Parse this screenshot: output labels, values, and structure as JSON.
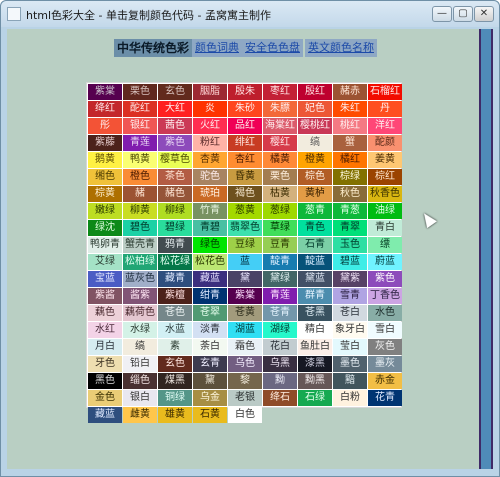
{
  "window": {
    "title": "html色彩大全 - 单击复制颜色代码 - 孟窝寓主制作"
  },
  "controls": {
    "min": "—",
    "max": "▢",
    "close": "✕"
  },
  "nav": {
    "active": "中华传统色彩",
    "links": [
      "颜色词典",
      "安全色色盘",
      "英文颜色名称"
    ]
  },
  "palette": {
    "rows": [
      [
        [
          "紫棠",
          "#56004f",
          "#cfc6cf"
        ],
        [
          "栗色",
          "#60281e",
          "#d8c2be"
        ],
        [
          "玄色",
          "#622a1d",
          "#d8c2be"
        ],
        [
          "胭脂",
          "#9d2933",
          "#ffd6d6"
        ],
        [
          "殷朱",
          "#be1e2d",
          "#ffe0e0"
        ],
        [
          "枣红",
          "#c32136",
          "#ffe0e0"
        ],
        [
          "殷红",
          "#be002f",
          "#ffe0e0"
        ],
        [
          "赭赤",
          "#9c5333",
          "#ffe6d6"
        ],
        [
          "石榴红",
          "#f20c00",
          "#ffeaea"
        ]
      ],
      [
        [
          "绛红",
          "#c3272b",
          "#ffe6e6"
        ],
        [
          "酡红",
          "#dc3023",
          "#ffe6e6"
        ],
        [
          "大红",
          "#ff2121",
          "#ffeeee"
        ],
        [
          "炎",
          "#ff3300",
          "#ffeeee"
        ],
        [
          "朱砂",
          "#ff461f",
          "#ffeeee"
        ],
        [
          "朱膘",
          "#f36838",
          "#ffeeee"
        ],
        [
          "妃色",
          "#ed5736",
          "#ffeeee"
        ],
        [
          "朱红",
          "#ff4c00",
          "#ffeeee"
        ],
        [
          "丹",
          "#ff4e20",
          "#ffeeee"
        ]
      ],
      [
        [
          "彤",
          "#f35336",
          "#ffeeee"
        ],
        [
          "银红",
          "#f05654",
          "#ffeeee"
        ],
        [
          "茜色",
          "#cb3a56",
          "#ffeeee"
        ],
        [
          "火红",
          "#ff2d51",
          "#ffeeee"
        ],
        [
          "品红",
          "#f00056",
          "#ffeeee"
        ],
        [
          "海棠红",
          "#db5a6b",
          "#ffeeee"
        ],
        [
          "樱桃红",
          "#c93756",
          "#ffeeee"
        ],
        [
          "桃红",
          "#f47983",
          "#ffeeee"
        ],
        [
          "洋红",
          "#ff4777",
          "#ffeeee"
        ]
      ],
      [
        [
          "紫藤",
          "#4c221b",
          "#e6cccc"
        ],
        [
          "青莲",
          "#801dae",
          "#ead8f4"
        ],
        [
          "紫色",
          "#8d4bbb",
          "#ead8f4"
        ],
        [
          "粉红",
          "#ffb3a7",
          "#5a2a2a"
        ],
        [
          "绯红",
          "#c83c23",
          "#ffe6e0"
        ],
        [
          "樱红",
          "#d63b4a",
          "#ffe6e6"
        ],
        [
          "缟",
          "#f2ecde",
          "#555555"
        ],
        [
          "蟹",
          "#a9613e",
          "#ffe6d6"
        ],
        [
          "酡颜",
          "#f9906f",
          "#5a2a1a"
        ]
      ],
      [
        [
          "鹅黄",
          "#fff143",
          "#5a4a00"
        ],
        [
          "鸭黄",
          "#faff72",
          "#4a4a00"
        ],
        [
          "樱草色",
          "#eaff56",
          "#4a4a00"
        ],
        [
          "杏黄",
          "#ffa631",
          "#5a3000"
        ],
        [
          "杏红",
          "#ff8c31",
          "#4a1a00"
        ],
        [
          "橘黄",
          "#ff8936",
          "#4a1a00"
        ],
        [
          "橙黄",
          "#ffa400",
          "#4a2a00"
        ],
        [
          "橘红",
          "#ff7500",
          "#4a1a00"
        ],
        [
          "姜黄",
          "#ffc773",
          "#4a2a00"
        ]
      ],
      [
        [
          "缃色",
          "#f0c239",
          "#4a3a00"
        ],
        [
          "橙色",
          "#fa8c35",
          "#4a1a00"
        ],
        [
          "茶色",
          "#b35c44",
          "#ffe6d6"
        ],
        [
          "驼色",
          "#a88462",
          "#ffeeee"
        ],
        [
          "昏黄",
          "#c89b40",
          "#3a2a00"
        ],
        [
          "栗色",
          "#a37d51",
          "#fff0e0"
        ],
        [
          "棕色",
          "#b25d25",
          "#fff0e0"
        ],
        [
          "棕绿",
          "#827100",
          "#fffadd"
        ],
        [
          "棕红",
          "#9b4400",
          "#ffe6cc"
        ]
      ],
      [
        [
          "棕黄",
          "#ae7000",
          "#fff0d0"
        ],
        [
          "赭",
          "#9c5333",
          "#ffe6d6"
        ],
        [
          "赭色",
          "#955539",
          "#ffe6d6"
        ],
        [
          "琥珀",
          "#ca6924",
          "#fff0e0"
        ],
        [
          "褐色",
          "#6e511e",
          "#f4e6cc"
        ],
        [
          "枯黄",
          "#d3b17d",
          "#3a2a00"
        ],
        [
          "黄栌",
          "#e29c45",
          "#3a2000"
        ],
        [
          "秋色",
          "#896c39",
          "#fff0d0"
        ],
        [
          "秋香色",
          "#d9b611",
          "#3a3000"
        ]
      ],
      [
        [
          "嫩绿",
          "#bddd22",
          "#2a3a00"
        ],
        [
          "柳黄",
          "#c9dd22",
          "#2a3a00"
        ],
        [
          "柳绿",
          "#afdd22",
          "#2a3a00"
        ],
        [
          "竹青",
          "#789262",
          "#e8f4e0"
        ],
        [
          "葱黄",
          "#a3d900",
          "#2a3a00"
        ],
        [
          "葱绿",
          "#9ed900",
          "#2a3a00"
        ],
        [
          "葱青",
          "#0eb83a",
          "#e0ffe6"
        ],
        [
          "青葱",
          "#0eb83a",
          "#e0ffe6"
        ],
        [
          "油绿",
          "#00bc12",
          "#e0ffe6"
        ]
      ],
      [
        [
          "绿沈",
          "#0c8918",
          "#e0ffe0"
        ],
        [
          "碧色",
          "#1bd1a5",
          "#003a2a"
        ],
        [
          "碧绿",
          "#2add9c",
          "#003a2a"
        ],
        [
          "青碧",
          "#48c0a3",
          "#003a2a"
        ],
        [
          "翡翠色",
          "#3de1ad",
          "#003a2a"
        ],
        [
          "草绿",
          "#40de5a",
          "#003a00"
        ],
        [
          "青色",
          "#00e09e",
          "#003a2a"
        ],
        [
          "青翠",
          "#00e079",
          "#003a2a"
        ],
        [
          "青白",
          "#c0ebd7",
          "#2a3a30"
        ]
      ],
      [
        [
          "鸭卵青",
          "#e0eee8",
          "#2a3a30"
        ],
        [
          "蟹壳青",
          "#bbcdc5",
          "#2a3a30"
        ],
        [
          "鸦青",
          "#424c50",
          "#e0e8ea"
        ],
        [
          "绿色",
          "#00e500",
          "#003a00"
        ],
        [
          "豆绿",
          "#9ed048",
          "#2a3a00"
        ],
        [
          "豆青",
          "#96ce54",
          "#2a3a00"
        ],
        [
          "石青",
          "#7bcfa6",
          "#003a2a"
        ],
        [
          "玉色",
          "#2edfa3",
          "#003a2a"
        ],
        [
          "缥",
          "#7fecad",
          "#003a20"
        ]
      ],
      [
        [
          "艾绿",
          "#a4e2c6",
          "#2a3a30"
        ],
        [
          "松柏绿",
          "#21a675",
          "#e0fff0"
        ],
        [
          "松花绿",
          "#057748",
          "#e0fff0"
        ],
        [
          "松花色",
          "#bce672",
          "#2a3a00"
        ],
        [
          "蓝",
          "#44cef6",
          "#002a3a"
        ],
        [
          "靛青",
          "#177cb0",
          "#e0f0ff"
        ],
        [
          "靛蓝",
          "#065279",
          "#d8ecff"
        ],
        [
          "碧蓝",
          "#3eede7",
          "#003a3a"
        ],
        [
          "蔚蓝",
          "#70f3ff",
          "#003a3a"
        ]
      ],
      [
        [
          "宝蓝",
          "#4b5cc4",
          "#e6eaff"
        ],
        [
          "蓝灰色",
          "#a1afc9",
          "#1a2a3a"
        ],
        [
          "藏青",
          "#2e4e7e",
          "#e0eaff"
        ],
        [
          "藏蓝",
          "#3b2e7e",
          "#e6e0ff"
        ],
        [
          "黛",
          "#4a4266",
          "#eae6ff"
        ],
        [
          "黛绿",
          "#426666",
          "#e0f0f0"
        ],
        [
          "黛蓝",
          "#425066",
          "#e0e8f4"
        ],
        [
          "黛紫",
          "#574266",
          "#eee0f4"
        ],
        [
          "紫色",
          "#8d4bbb",
          "#ffffff"
        ]
      ],
      [
        [
          "紫酱",
          "#815463",
          "#ffe6ee"
        ],
        [
          "酱紫",
          "#815476",
          "#ffe6f4"
        ],
        [
          "紫檀",
          "#4c221b",
          "#ffe0e0"
        ],
        [
          "绀青",
          "#003371",
          "#e0eaff"
        ],
        [
          "紫棠",
          "#56004f",
          "#ffe0ff"
        ],
        [
          "青莲",
          "#801dae",
          "#ffe6ff"
        ],
        [
          "群青",
          "#4c8dae",
          "#e6f4ff"
        ],
        [
          "雪青",
          "#b0a4e3",
          "#2a2040"
        ],
        [
          "丁香色",
          "#cca4e3",
          "#2a2040"
        ]
      ],
      [
        [
          "藕色",
          "#edd1d8",
          "#4a2a30"
        ],
        [
          "藕荷色",
          "#e4c6d0",
          "#4a2a30"
        ],
        [
          "苍色",
          "#75878a",
          "#eef4f4"
        ],
        [
          "苍翠",
          "#519a73",
          "#e6ffee"
        ],
        [
          "苍黄",
          "#a29b7c",
          "#2a2a1a"
        ],
        [
          "苍青",
          "#7397ab",
          "#e6f4ff"
        ],
        [
          "苍黑",
          "#395260",
          "#e0eef4"
        ],
        [
          "苍白",
          "#d1d9e0",
          "#2a3038"
        ],
        [
          "水色",
          "#88ada6",
          "#1a2a28"
        ]
      ],
      [
        [
          "水红",
          "#f3d3e7",
          "#4a2a3a"
        ],
        [
          "水绿",
          "#d4f2e7",
          "#2a3a30"
        ],
        [
          "水蓝",
          "#d2f0f4",
          "#2a3a3a"
        ],
        [
          "淡青",
          "#d3e0f3",
          "#2a303a"
        ],
        [
          "湖蓝",
          "#30dff3",
          "#003a3a"
        ],
        [
          "湖绿",
          "#25f8cb",
          "#003a30"
        ],
        [
          "精白",
          "#ffffff",
          "#333333"
        ],
        [
          "象牙白",
          "#fffbf0",
          "#333333"
        ],
        [
          "雪白",
          "#f0fcff",
          "#333333"
        ]
      ],
      [
        [
          "月白",
          "#d6ecf0",
          "#2a3038"
        ],
        [
          "缟",
          "#f2ecde",
          "#333333"
        ],
        [
          "素",
          "#e0f0e9",
          "#2a3a30"
        ],
        [
          "荼白",
          "#f3f9f1",
          "#333333"
        ],
        [
          "霜色",
          "#e9f1f6",
          "#333333"
        ],
        [
          "花白",
          "#c2ccd0",
          "#2a3038"
        ],
        [
          "鱼肚白",
          "#fcefe8",
          "#333333"
        ],
        [
          "莹白",
          "#e3f9fd",
          "#333333"
        ],
        [
          "灰色",
          "#808080",
          "#f4f4f4"
        ]
      ],
      [
        [
          "牙色",
          "#eedeb0",
          "#3a3020"
        ],
        [
          "铅白",
          "#f0f0f4",
          "#333333"
        ],
        [
          "玄色",
          "#622a1d",
          "#ffe6e0"
        ],
        [
          "玄青",
          "#3d3b4f",
          "#eeeeff"
        ],
        [
          "乌色",
          "#725e82",
          "#f4eeff"
        ],
        [
          "乌黑",
          "#392f41",
          "#eee6f4"
        ],
        [
          "漆黑",
          "#161823",
          "#d0d0e0"
        ],
        [
          "墨色",
          "#50616d",
          "#e6eef4"
        ],
        [
          "墨灰",
          "#758a99",
          "#eef4f8"
        ]
      ],
      [
        [
          "黑色",
          "#000000",
          "#dddddd"
        ],
        [
          "缁色",
          "#493131",
          "#f4e6e6"
        ],
        [
          "煤黑",
          "#312520",
          "#eee6e0"
        ],
        [
          "黧",
          "#5d513c",
          "#f4eee0"
        ],
        [
          "黎",
          "#75664d",
          "#f4eee0"
        ],
        [
          "黝",
          "#6b6882",
          "#eeeef8"
        ],
        [
          "黝黑",
          "#665757",
          "#f4eeee"
        ],
        [
          "黯",
          "#41555d",
          "#e6f0f4"
        ],
        [
          "赤金",
          "#f2be45",
          "#3a2a00"
        ]
      ],
      [
        [
          "金色",
          "#eacd76",
          "#3a3000"
        ],
        [
          "银白",
          "#e9e7ef",
          "#333333"
        ],
        [
          "铜绿",
          "#549688",
          "#e6fff8"
        ],
        [
          "乌金",
          "#a78e44",
          "#fff8e0"
        ],
        [
          "老银",
          "#bacac6",
          "#2a3030"
        ],
        [
          "绛石",
          "#8f4b28",
          "#ffeee0"
        ],
        [
          "石绿",
          "#16a951",
          "#e6ffee"
        ],
        [
          "白粉",
          "#fff2df",
          "#333333"
        ],
        [
          "花青",
          "#003472",
          "#e0eaff"
        ]
      ]
    ],
    "last_row": [
      [
        "藏蓝",
        "#2e4e7e",
        "#e0eaff"
      ],
      [
        "雌黄",
        "#ffc64b",
        "#3a2a00"
      ],
      [
        "雄黄",
        "#e9bb1d",
        "#3a2a00"
      ],
      [
        "石黄",
        "#e9bb1d",
        "#3a2a00"
      ],
      [
        "白色",
        "#ffffff",
        "#333333"
      ]
    ]
  }
}
